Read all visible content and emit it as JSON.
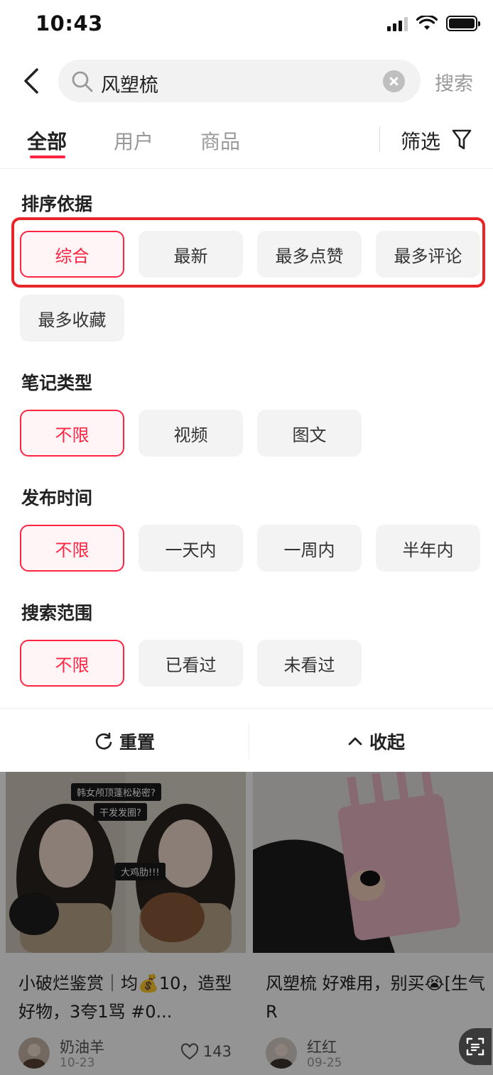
{
  "status_bar": {
    "time": "10:43"
  },
  "search": {
    "query": "风塑梳",
    "submit_label": "搜索"
  },
  "tabs": [
    {
      "label": "全部",
      "active": true
    },
    {
      "label": "用户",
      "active": false
    },
    {
      "label": "商品",
      "active": false
    }
  ],
  "filter_button_label": "筛选",
  "filter_panel": {
    "sort": {
      "title": "排序依据",
      "options": [
        "综合",
        "最新",
        "最多点赞",
        "最多评论",
        "最多收藏"
      ],
      "selected": "综合"
    },
    "note_type": {
      "title": "笔记类型",
      "options": [
        "不限",
        "视频",
        "图文"
      ],
      "selected": "不限"
    },
    "publish_time": {
      "title": "发布时间",
      "options": [
        "不限",
        "一天内",
        "一周内",
        "半年内"
      ],
      "selected": "不限"
    },
    "search_scope": {
      "title": "搜索范围",
      "options": [
        "不限",
        "已看过",
        "未看过"
      ],
      "selected": "不限"
    }
  },
  "actions": {
    "reset_label": "重置",
    "collapse_label": "收起"
  },
  "feed": [
    {
      "title": "小破烂鉴赏｜均💰10，造型好物，3夸1骂 #0...",
      "author": "奶油羊",
      "date": "10-23",
      "likes": "143",
      "image_tags": [
        "韩女颅顶蓬松秘密?",
        "干发发圈?",
        "大鸡肋!!!"
      ]
    },
    {
      "title": "风塑梳 好难用，别买😭[生气R",
      "author": "红红",
      "date": "09-25",
      "likes": ""
    }
  ],
  "colors": {
    "accent": "#ff2442",
    "highlight_box": "#e8262a"
  }
}
